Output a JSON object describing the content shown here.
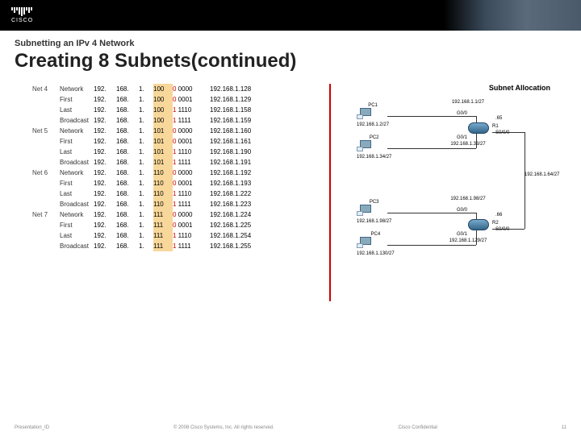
{
  "header": {
    "logo_text": "CISCO"
  },
  "supertitle": "Subnetting an IPv 4 Network",
  "title": "Creating 8 Subnets(continued)",
  "subnets": [
    {
      "label": "Net 4",
      "rows": [
        {
          "type": "Network",
          "a": "192.",
          "b": "168.",
          "c": "1.",
          "d": "100",
          "bin_hi": "0",
          "bin_lo": "0000",
          "full": "192.168.1.128"
        },
        {
          "type": "First",
          "a": "192.",
          "b": "168.",
          "c": "1.",
          "d": "100",
          "bin_hi": "0",
          "bin_lo": "0001",
          "full": "192.168.1.129"
        },
        {
          "type": "Last",
          "a": "192.",
          "b": "168.",
          "c": "1.",
          "d": "100",
          "bin_hi": "1",
          "bin_lo": "1110",
          "full": "192.168.1.158"
        },
        {
          "type": "Broadcast",
          "a": "192.",
          "b": "168.",
          "c": "1.",
          "d": "100",
          "bin_hi": "1",
          "bin_lo": "1111",
          "full": "192.168.1.159"
        }
      ]
    },
    {
      "label": "Net 5",
      "rows": [
        {
          "type": "Network",
          "a": "192.",
          "b": "168.",
          "c": "1.",
          "d": "101",
          "bin_hi": "0",
          "bin_lo": "0000",
          "full": "192.168.1.160"
        },
        {
          "type": "First",
          "a": "192.",
          "b": "168.",
          "c": "1.",
          "d": "101",
          "bin_hi": "0",
          "bin_lo": "0001",
          "full": "192.168.1.161"
        },
        {
          "type": "Last",
          "a": "192.",
          "b": "168.",
          "c": "1.",
          "d": "101",
          "bin_hi": "1",
          "bin_lo": "1110",
          "full": "192.168.1.190"
        },
        {
          "type": "Broadcast",
          "a": "192.",
          "b": "168.",
          "c": "1.",
          "d": "101",
          "bin_hi": "1",
          "bin_lo": "1111",
          "full": "192.168.1.191"
        }
      ]
    },
    {
      "label": "Net 6",
      "rows": [
        {
          "type": "Network",
          "a": "192.",
          "b": "168.",
          "c": "1.",
          "d": "110",
          "bin_hi": "0",
          "bin_lo": "0000",
          "full": "192.168.1.192"
        },
        {
          "type": "First",
          "a": "192.",
          "b": "168.",
          "c": "1.",
          "d": "110",
          "bin_hi": "0",
          "bin_lo": "0001",
          "full": "192.168.1.193"
        },
        {
          "type": "Last",
          "a": "192.",
          "b": "168.",
          "c": "1.",
          "d": "110",
          "bin_hi": "1",
          "bin_lo": "1110",
          "full": "192.168.1.222"
        },
        {
          "type": "Broadcast",
          "a": "192.",
          "b": "168.",
          "c": "1.",
          "d": "110",
          "bin_hi": "1",
          "bin_lo": "1111",
          "full": "192.168.1.223"
        }
      ]
    },
    {
      "label": "Net 7",
      "rows": [
        {
          "type": "Network",
          "a": "192.",
          "b": "168.",
          "c": "1.",
          "d": "111",
          "bin_hi": "0",
          "bin_lo": "0000",
          "full": "192.168.1.224"
        },
        {
          "type": "First",
          "a": "192.",
          "b": "168.",
          "c": "1.",
          "d": "111",
          "bin_hi": "0",
          "bin_lo": "0001",
          "full": "192.168.1.225"
        },
        {
          "type": "Last",
          "a": "192.",
          "b": "168.",
          "c": "1.",
          "d": "111",
          "bin_hi": "1",
          "bin_lo": "1110",
          "full": "192.168.1.254"
        },
        {
          "type": "Broadcast",
          "a": "192.",
          "b": "168.",
          "c": "1.",
          "d": "111",
          "bin_hi": "1",
          "bin_lo": "1111",
          "full": "192.168.1.255"
        }
      ]
    }
  ],
  "diagram": {
    "title": "Subnet Allocation",
    "nodes": {
      "pc1": {
        "label": "PC1",
        "ip": "192.168.1.2/27"
      },
      "pc2": {
        "label": "PC2",
        "ip": "192.168.1.34/27"
      },
      "pc3": {
        "label": "PC3",
        "ip": "192.168.1.98/27"
      },
      "pc4": {
        "label": "PC4",
        "ip": "192.168.1.130/27"
      },
      "r1": {
        "label": "R1",
        "top": "192.168.1.1/27",
        "bot": "192.168.1.33/27",
        "right": ".65",
        "port_top": "G0/0",
        "port_bot": "G0/1",
        "port_r": "S0/0/0"
      },
      "r2": {
        "label": "R2",
        "top": "192.168.1.98/27",
        "bot": "192.168.1.129/27",
        "right": ".66",
        "port_top": "G0/0",
        "port_bot": "G0/1",
        "port_r": "S0/0/0"
      },
      "serial": "192.168.1.64/27"
    }
  },
  "footer": {
    "left": "Presentation_ID",
    "mid": "© 2008 Cisco Systems, Inc. All rights reserved.",
    "right": "Cisco Confidential",
    "page": "11"
  }
}
